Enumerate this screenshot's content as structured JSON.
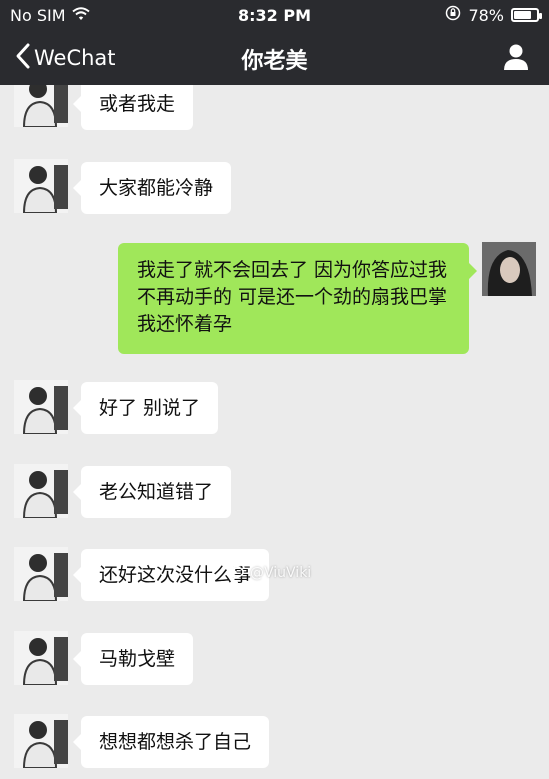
{
  "status_bar": {
    "carrier": "No SIM",
    "time": "8:32 PM",
    "battery_percent": "78%",
    "battery_level": 0.78
  },
  "nav_bar": {
    "back_label": "WeChat",
    "title": "你老美"
  },
  "messages": [
    {
      "side": "left",
      "text": "或者我走"
    },
    {
      "side": "left",
      "text": "大家都能冷静"
    },
    {
      "side": "right",
      "text": "我走了就不会回去了 因为你答应过我不再动手的 可是还一个劲的扇我巴掌 我还怀着孕"
    },
    {
      "side": "left",
      "text": "好了 别说了"
    },
    {
      "side": "left",
      "text": "老公知道错了"
    },
    {
      "side": "left",
      "text": "还好这次没什么事"
    },
    {
      "side": "left",
      "text": "马勒戈壁"
    },
    {
      "side": "left",
      "text": "想想都想杀了自己"
    }
  ],
  "watermark": "@ViuViki",
  "colors": {
    "bar_bg": "#2a2b2f",
    "chat_bg": "#ebebeb",
    "sent_bubble": "#a0e75a",
    "received_bubble": "#ffffff"
  }
}
